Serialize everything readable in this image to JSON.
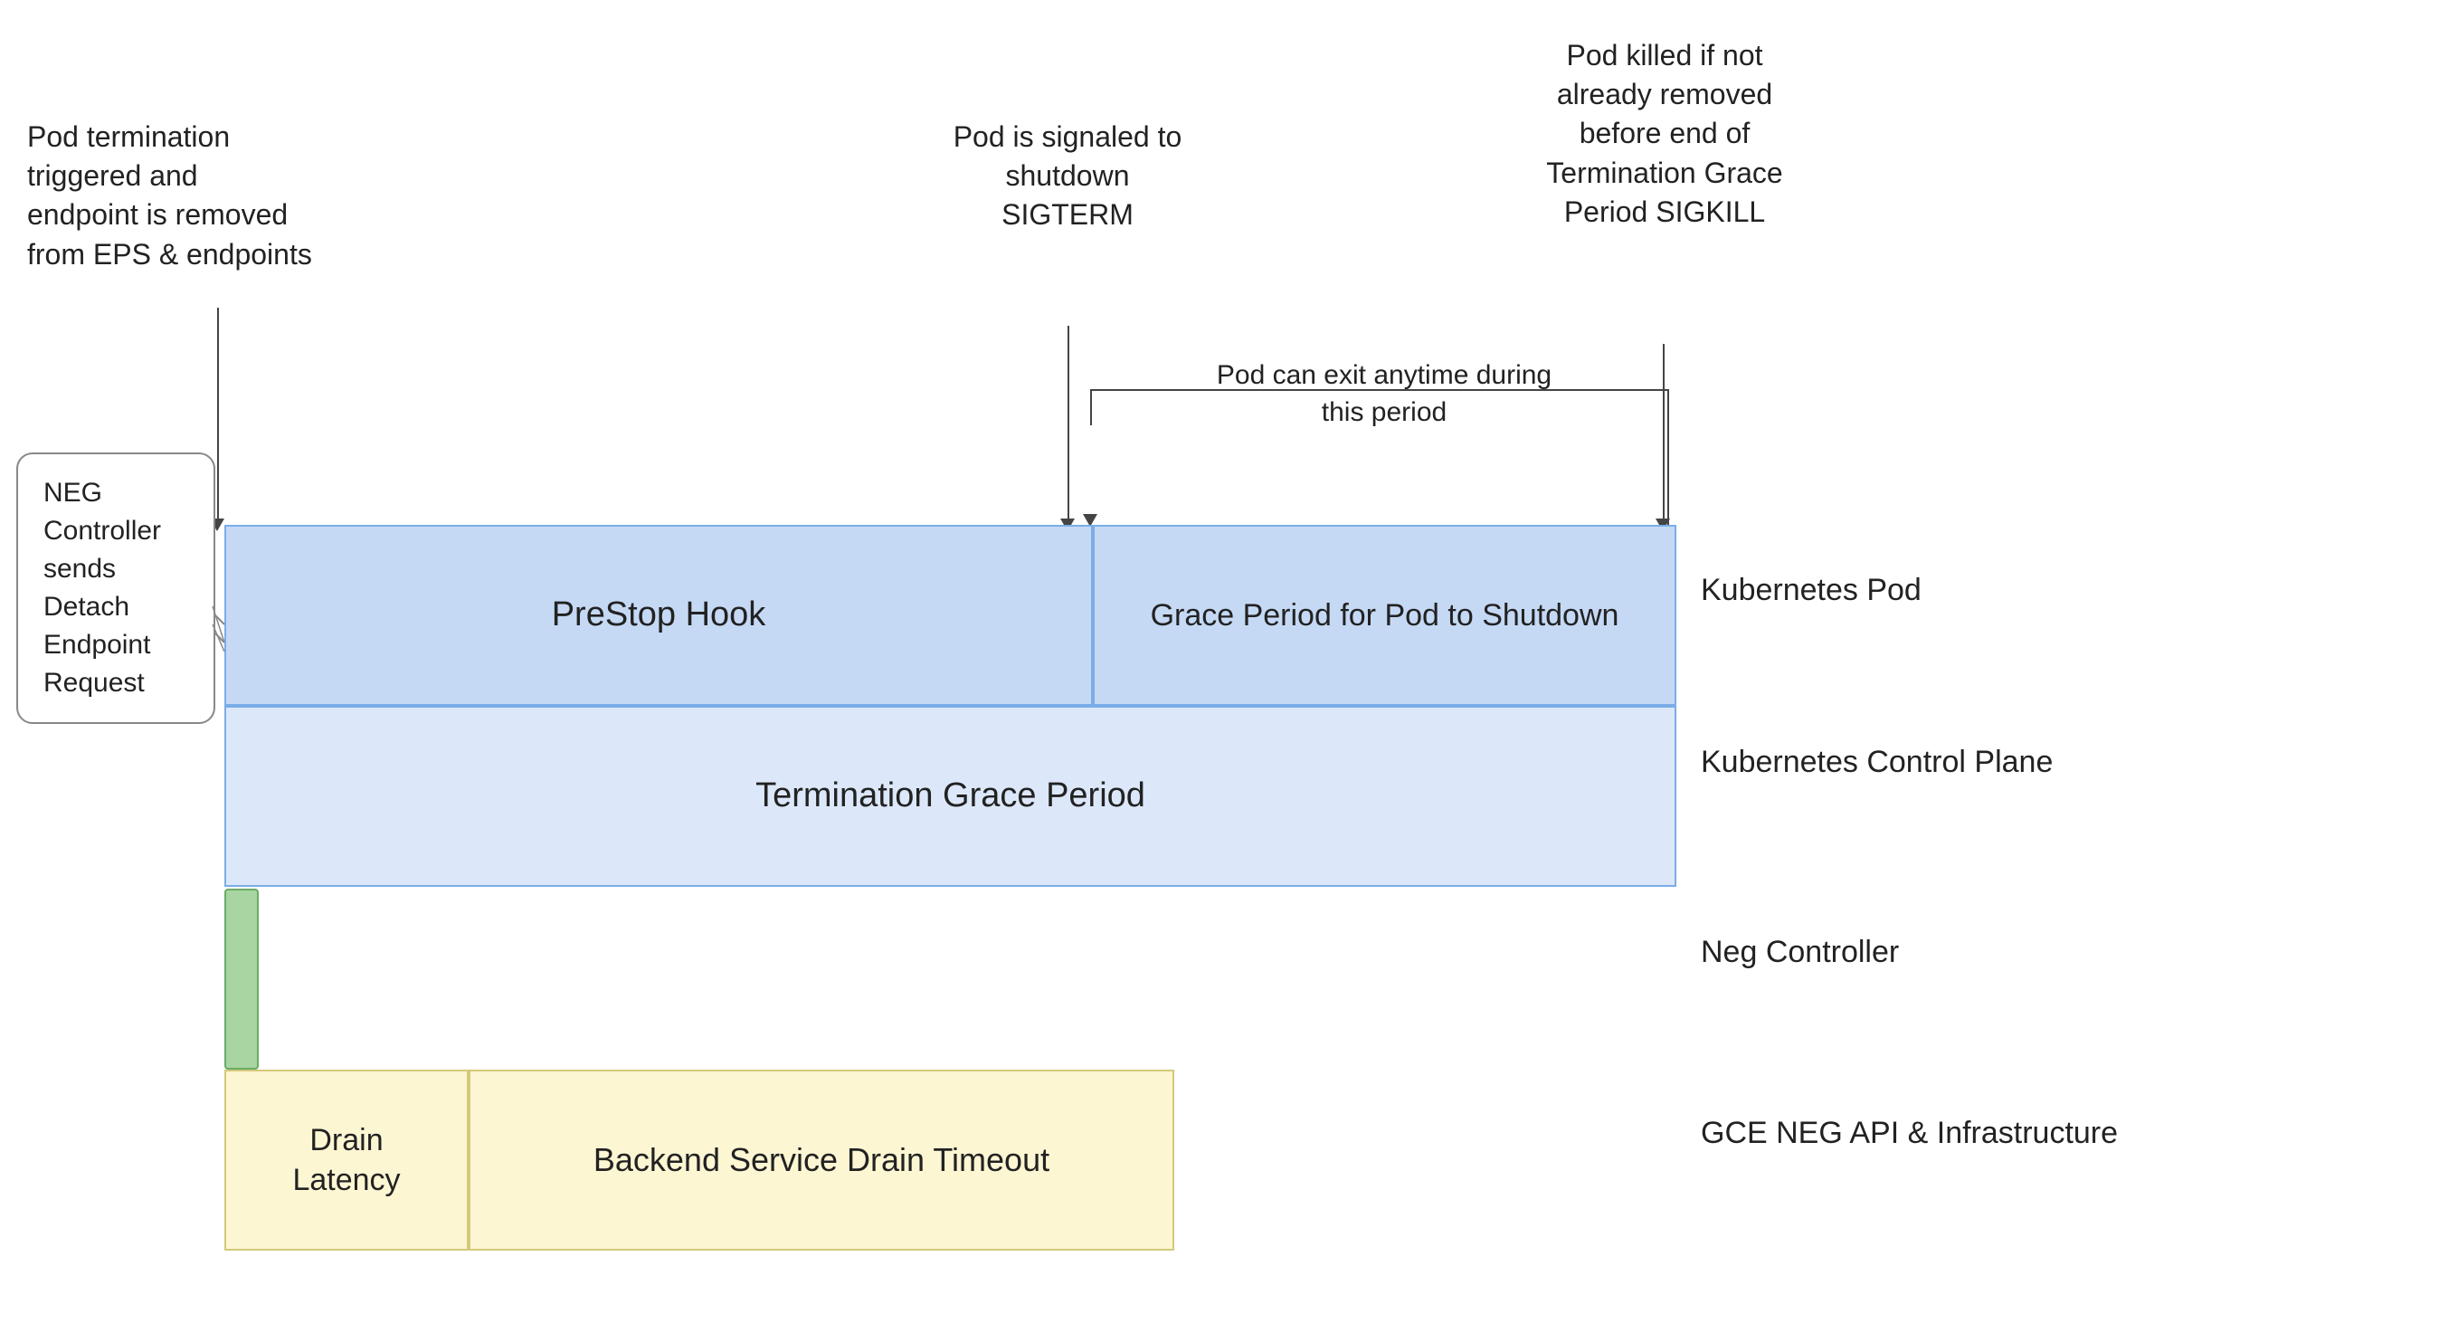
{
  "annotations": {
    "pod_termination": "Pod termination triggered\nand endpoint is removed\nfrom EPS & endpoints",
    "pod_signaled": "Pod is signaled to\nshutdown\nSIGTERM",
    "pod_killed": "Pod killed if not\nalready removed\nbefore end of\nTermination Grace\nPeriod\nSIGKILL",
    "pod_can_exit": "Pod can exit anytime\nduring this period"
  },
  "boxes": {
    "prestop_hook": "PreStop Hook",
    "grace_period": "Grace Period for\nPod to Shutdown",
    "termination_grace_period": "Termination Grace Period",
    "drain_latency": "Drain\nLatency",
    "backend_service_drain": "Backend Service Drain Timeout"
  },
  "neg_bubble": "NEG\nController\nsends\nDetach\nEndpoint\nRequest",
  "row_labels": {
    "kubernetes_pod": "Kubernetes Pod",
    "kubernetes_control_plane": "Kubernetes\nControl Plane",
    "neg_controller": "Neg Controller",
    "gce_neg": "GCE NEG API &\nInfrastructure"
  }
}
